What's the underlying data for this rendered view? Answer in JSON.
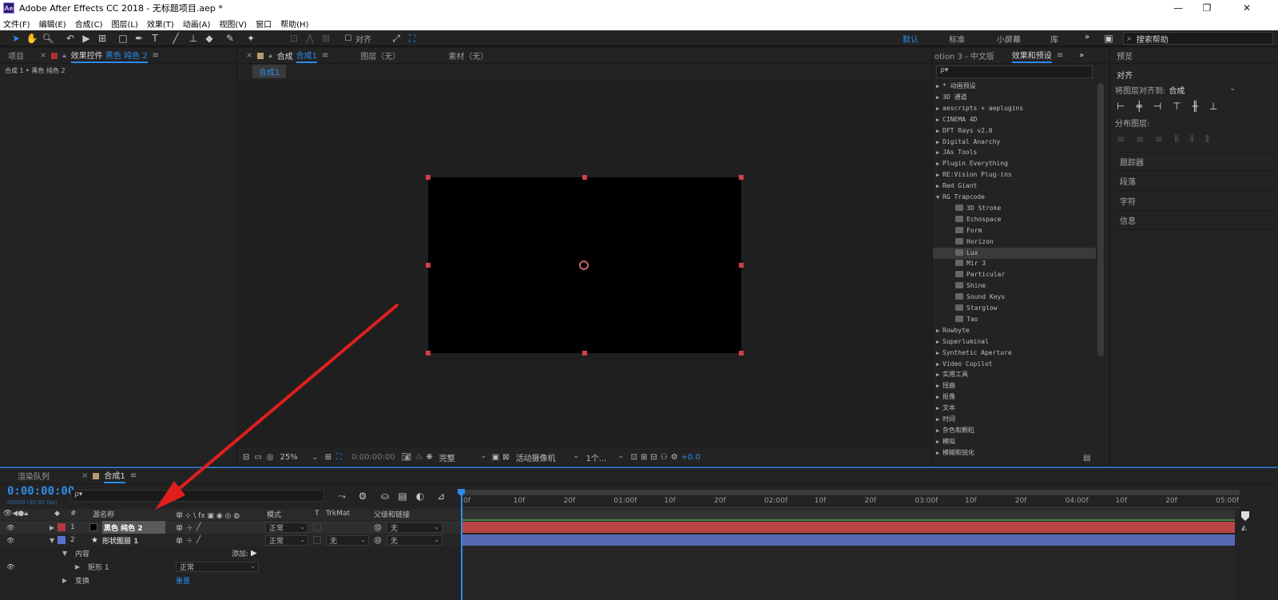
{
  "window": {
    "title": "Adobe After Effects CC 2018 - 无标题项目.aep *",
    "app_icon": "Ae",
    "minimize_icon": "minimize-icon",
    "maximize_icon": "maximize-icon",
    "close_icon": "close-icon"
  },
  "menu": [
    "文件(F)",
    "编辑(E)",
    "合成(C)",
    "图层(L)",
    "效果(T)",
    "动画(A)",
    "视图(V)",
    "窗口",
    "帮助(H)"
  ],
  "toolbar": {
    "align_label": "对齐",
    "workspaces": [
      "默认",
      "标准",
      "小屏幕",
      "库"
    ],
    "active_workspace": "默认",
    "more": "»",
    "search_placeholder": "搜索帮助"
  },
  "project_panel": {
    "tab_project": "项目",
    "tab_effect_controls": "效果控件",
    "effect_controls_target": "黑色 纯色 2",
    "breadcrumb": "合成 1 • 黑色 纯色 2"
  },
  "comp_panel": {
    "tab_comp_prefix": "合成",
    "tab_comp_name": "合成1",
    "tab_layer": "图层（无）",
    "tab_footage": "素材（无）",
    "comp_flowchart_tab": "合成1",
    "zoom": "25%",
    "timecode": "0:00:00:00",
    "resolution": "完整",
    "camera": "活动摄像机",
    "views": "1个...",
    "exposure": "+0.0",
    "solid_color": "#000000",
    "handle_color": "#c83c3c"
  },
  "effects_panel": {
    "tab_motion3": "otion 3 - 中文版",
    "tab_effects_presets": "效果和预设",
    "search_placeholder": "ρ▾",
    "items": [
      {
        "label": "* 动画预设",
        "expanded": false
      },
      {
        "label": "3D 通道",
        "expanded": false
      },
      {
        "label": "aescripts + aeplugins",
        "expanded": false
      },
      {
        "label": "CINEMA 4D",
        "expanded": false
      },
      {
        "label": "DFT Rays v2.0",
        "expanded": false
      },
      {
        "label": "Digital Anarchy",
        "expanded": false
      },
      {
        "label": "JAs Tools",
        "expanded": false
      },
      {
        "label": "Plugin Everything",
        "expanded": false
      },
      {
        "label": "RE:Vision Plug-ins",
        "expanded": false
      },
      {
        "label": "Red Giant",
        "expanded": false
      },
      {
        "label": "RG Trapcode",
        "expanded": true
      }
    ],
    "trapcode_children": [
      "3D Stroke",
      "Echospace",
      "Form",
      "Horizon",
      "Lux",
      "Mir 3",
      "Particular",
      "Shine",
      "Sound Keys",
      "Starglow",
      "Tao"
    ],
    "selected_child": "Lux",
    "more_items": [
      "Rowbyte",
      "Superluminal",
      "Synthetic Aperture",
      "Video Copilot",
      "实用工具",
      "扭曲",
      "抠像",
      "文本",
      "时间",
      "杂色和颗粒",
      "模拟",
      "模糊和锐化"
    ]
  },
  "right_panel": {
    "tab_preview": "预览",
    "align_title": "对齐",
    "align_to_label": "将图层对齐到:",
    "align_to_value": "合成",
    "distribute_label": "分布图层:",
    "sections": [
      "跟踪器",
      "段落",
      "字符",
      "信息"
    ]
  },
  "timeline": {
    "tab_render_queue": "渲染队列",
    "tab_comp": "合成1",
    "timecode": "0:00:00:00",
    "fps": "00000 (30.00 fps)",
    "search_placeholder": "ρ▾",
    "col_hash": "#",
    "col_source": "源名称",
    "col_switches": "单 ⊹ \\ fx ▣ ◉ ◎ ◍",
    "col_mode": "模式",
    "col_t": "T",
    "col_trkmat": "TrkMat",
    "col_parent": "父级和链接",
    "ruler": [
      "0f",
      "10f",
      "20f",
      "01:00f",
      "10f",
      "20f",
      "02:00f",
      "10f",
      "20f",
      "03:00f",
      "10f",
      "20f",
      "04:00f",
      "10f",
      "20f",
      "05:00f"
    ],
    "layers": [
      {
        "num": "1",
        "name": "黑色 纯色 2",
        "mode": "正常",
        "trkmat": "",
        "parent": "无",
        "label_color": "#b33a3a",
        "bar_color": "#b94545"
      },
      {
        "num": "2",
        "name": "形状图层 1",
        "mode": "正常",
        "trkmat": "无",
        "parent": "无",
        "label_color": "#5b6fd1",
        "bar_color": "#5868b0"
      }
    ],
    "contents_label": "内容",
    "add_label": "添加:",
    "rect_label": "矩形 1",
    "rect_mode": "正常",
    "transform_label": "变换",
    "transform_value": "重置"
  }
}
